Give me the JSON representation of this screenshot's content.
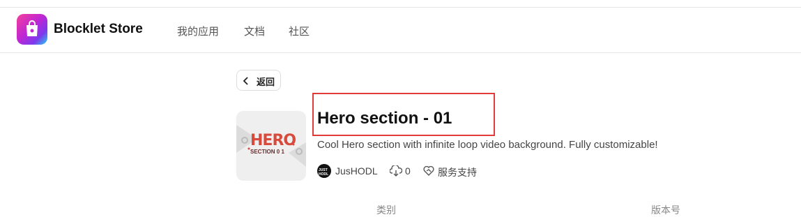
{
  "header": {
    "brand": "Blocklet Store",
    "nav": [
      "我的应用",
      "文档",
      "社区"
    ]
  },
  "back_label": "返回",
  "blocklet": {
    "thumb_title": "HERO",
    "thumb_sub": "SECTION 0 1",
    "title": "Hero section - 01",
    "description": "Cool Hero section with infinite loop video background. Fully customizable!",
    "author": "JusHODL",
    "avatar_text": "JUST HODL",
    "downloads": "0",
    "support_label": "服务支持"
  },
  "columns": [
    "类别",
    "版本号"
  ],
  "colors": {
    "highlight": "#e23b3b",
    "brand_gradient": [
      "#f43f9a",
      "#c026d3",
      "#7c3aed",
      "#22d3ee"
    ]
  }
}
